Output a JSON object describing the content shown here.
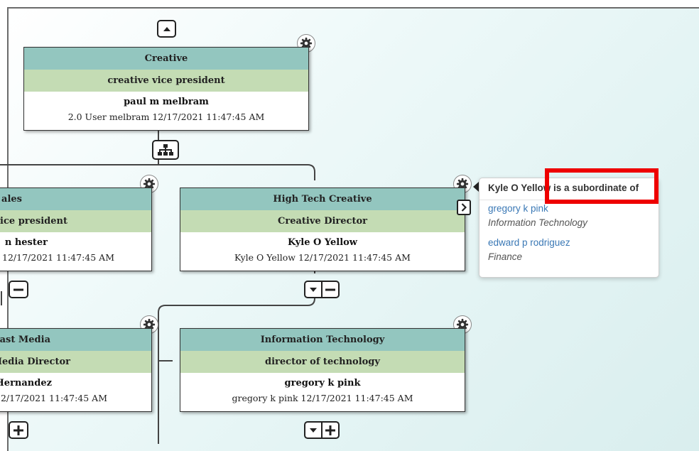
{
  "cards": {
    "creative": {
      "department": "Creative",
      "title": "creative vice president",
      "person": "paul m melbram",
      "meta": "2.0 User melbram 12/17/2021 11:47:45 AM"
    },
    "sales": {
      "department": "ales",
      "title": "vice president",
      "person": "n hester",
      "meta": "12/17/2021 11:47:45 AM"
    },
    "high_tech_creative": {
      "department": "High Tech Creative",
      "title": "Creative Director",
      "person": "Kyle O Yellow",
      "meta": "Kyle O Yellow 12/17/2021 11:47:45 AM"
    },
    "broadcast_media": {
      "department": "ast Media",
      "title": "Media Director",
      "person": "Hernandez",
      "meta": "2/17/2021 11:47:45 AM"
    },
    "information_technology": {
      "department": "Information Technology",
      "title": "director of technology",
      "person": "gregory k pink",
      "meta": "gregory k pink 12/17/2021 11:47:45 AM"
    }
  },
  "popup": {
    "heading": "Kyle O Yellow is a subordinate of",
    "managers": [
      {
        "name": "gregory k pink",
        "department": "Information Technology"
      },
      {
        "name": "edward p rodriguez",
        "department": "Finance"
      }
    ]
  },
  "icons": {
    "gear": "gear-icon",
    "expand_up": "chevron-up-icon",
    "org_chart": "org-chart-icon",
    "collapse": "minus-icon",
    "expand": "plus-icon",
    "chevron_down": "chevron-down-icon",
    "chevron_right": "chevron-right-icon"
  },
  "colors": {
    "department_band": "#93c6bf",
    "title_band": "#c4dcb4",
    "link": "#3a78b5",
    "highlight": "#ee0000"
  }
}
